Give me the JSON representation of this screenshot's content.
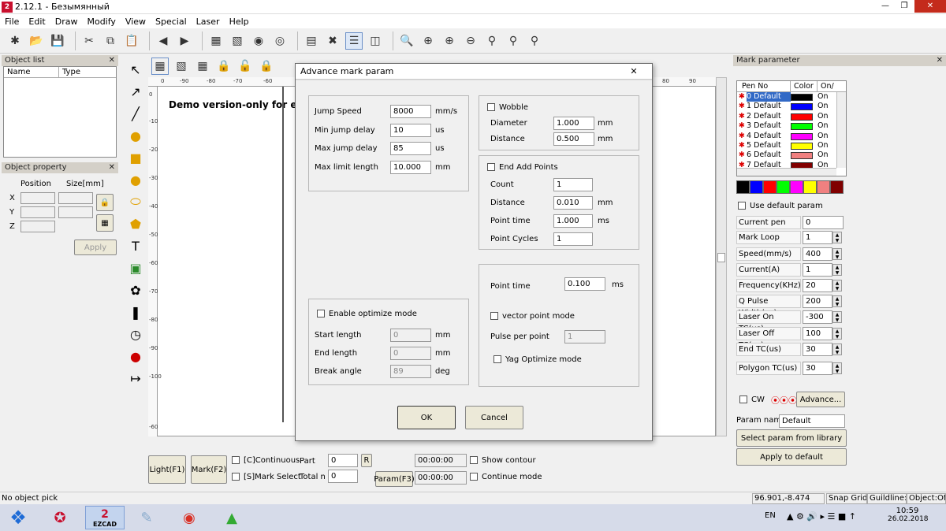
{
  "window": {
    "title": "2.12.1 - Безымянный",
    "app_icon": "2"
  },
  "menu": [
    "File",
    "Edit",
    "Draw",
    "Modify",
    "View",
    "Special",
    "Laser",
    "Help"
  ],
  "object_list": {
    "title": "Object list",
    "columns": [
      "Name",
      "Type"
    ]
  },
  "object_property": {
    "title": "Object property",
    "position_label": "Position",
    "size_label": "Size[mm]",
    "axes": [
      "X",
      "Y",
      "Z"
    ],
    "apply": "Apply"
  },
  "canvas": {
    "demo_text": "Demo version-only for evalu",
    "ruler_h": [
      "0",
      "-90",
      "-80",
      "-70",
      "-60",
      "80",
      "90"
    ],
    "ruler_v": [
      "0",
      "-10",
      "-20",
      "-30",
      "-40",
      "-50",
      "-60",
      "-70",
      "-80",
      "-90",
      "-100",
      "-60"
    ]
  },
  "dialog": {
    "title": "Advance mark param",
    "close": "✕",
    "jump": [
      {
        "label": "Jump Speed",
        "value": "8000",
        "unit": "mm/s"
      },
      {
        "label": "Min jump delay",
        "value": "10",
        "unit": "us"
      },
      {
        "label": "Max jump delay",
        "value": "85",
        "unit": "us"
      },
      {
        "label": "Max limit length",
        "value": "10.000",
        "unit": "mm"
      }
    ],
    "wobble": {
      "label": "Wobble",
      "diameter_label": "Diameter",
      "diameter": "1.000",
      "distance_label": "Distance",
      "distance": "0.500",
      "unit": "mm"
    },
    "end_add": {
      "label": "End Add Points",
      "count_label": "Count",
      "count": "1",
      "distance_label": "Distance",
      "distance": "0.010",
      "distance_unit": "mm",
      "point_time_label": "Point time",
      "point_time": "1.000",
      "point_time_unit": "ms",
      "cycles_label": "Point Cycles",
      "cycles": "1"
    },
    "optimize": {
      "label": "Enable optimize mode",
      "start_label": "Start length",
      "start": "0",
      "start_unit": "mm",
      "end_label": "End length",
      "end": "0",
      "end_unit": "mm",
      "angle_label": "Break angle",
      "angle": "89",
      "angle_unit": "deg"
    },
    "point": {
      "point_time_label": "Point time",
      "point_time": "0.100",
      "unit": "ms",
      "vector_label": "vector point mode",
      "pulse_label": "Pulse per point",
      "pulse": "1",
      "yag_label": "Yag Optimize mode"
    },
    "ok": "OK",
    "cancel": "Cancel"
  },
  "bottom": {
    "light": "Light(F1)",
    "mark": "Mark(F2)",
    "continuous": "[C]Continuous",
    "mark_select": "[S]Mark Select",
    "part_label": "Part",
    "part": "0",
    "r": "R",
    "total_label": "Total n",
    "total": "0",
    "param": "Param(F3)",
    "time1": "00:00:00",
    "time2": "00:00:00",
    "show_contour": "Show contour",
    "continue_mode": "Continue mode"
  },
  "mark_param": {
    "title": "Mark parameter",
    "columns": [
      "Pen No",
      "Color",
      "On/"
    ],
    "pens": [
      {
        "name": "0 Default",
        "color": "#000000",
        "on": "On"
      },
      {
        "name": "1 Default",
        "color": "#0000ff",
        "on": "On"
      },
      {
        "name": "2 Default",
        "color": "#ff0000",
        "on": "On"
      },
      {
        "name": "3 Default",
        "color": "#00ff00",
        "on": "On"
      },
      {
        "name": "4 Default",
        "color": "#ff00ff",
        "on": "On"
      },
      {
        "name": "5 Default",
        "color": "#ffff00",
        "on": "On"
      },
      {
        "name": "6 Default",
        "color": "#f08080",
        "on": "On"
      },
      {
        "name": "7 Default",
        "color": "#800000",
        "on": "On"
      }
    ],
    "palette": [
      "#000000",
      "#0000ff",
      "#ff0000",
      "#00ff00",
      "#ff00ff",
      "#ffff00",
      "#f08080",
      "#800000"
    ],
    "use_default": "Use default param",
    "params": [
      {
        "label": "Current pen",
        "value": "0"
      },
      {
        "label": "Mark Loop",
        "value": "1"
      },
      {
        "label": "Speed(mm/s)",
        "value": "400"
      },
      {
        "label": "Current(A)",
        "value": "1"
      },
      {
        "label": "Frequency(KHz)",
        "value": "20"
      },
      {
        "label": "Q Pulse Width(us)",
        "value": "200"
      },
      {
        "label": "Laser On TC(us)",
        "value": "-300"
      },
      {
        "label": "Laser Off TC(us)",
        "value": "100"
      },
      {
        "label": "End TC(us)",
        "value": "30"
      },
      {
        "label": "Polygon TC(us)",
        "value": "30"
      }
    ],
    "cw": "CW",
    "advance": "Advance...",
    "param_name_label": "Param name",
    "param_name": "Default",
    "select_lib": "Select param from library",
    "apply_default": "Apply to default"
  },
  "status": {
    "left": "No object pick",
    "coords": "96.901,-8.474",
    "snap": "Snap Grid:",
    "guide": "Guildline:(",
    "object": "Object:Off"
  },
  "taskbar": {
    "lang": "EN",
    "time": "10:59",
    "date": "26.02.2018",
    "ezcad": "EZCAD"
  }
}
